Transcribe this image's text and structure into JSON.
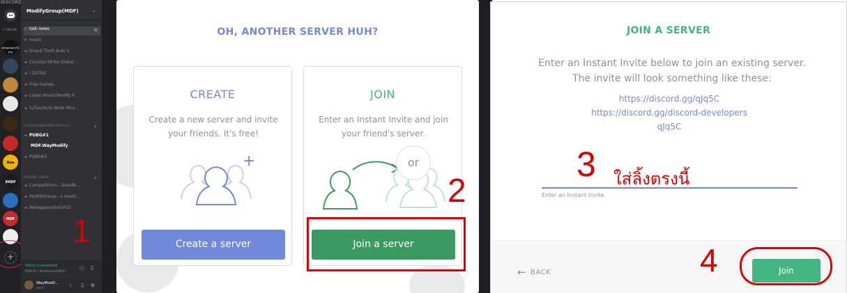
{
  "discord": {
    "brand": "DISCORD",
    "online_count": "5 ONLINE",
    "server_name": "ModifyGroup(MDF)",
    "guild_labels": [
      "สหายตายยากไม่ตาย",
      "Nua",
      "XHDF",
      "MDF"
    ],
    "channels": {
      "talk_news": "talk-news",
      "music": "music",
      "voice_1": [
        "Grand Theft Auto V",
        "Counter-Strike Global ...",
        "\\ DOTA2",
        "Free Games",
        "Listen Music(Modify P...",
        "ไม่ใมย(Auto Mute Micr..."
      ],
      "category_pubg": "PLAYERUNKNOWN'S BATTLEG...",
      "pubg1": "PUBG#1",
      "pubg1_member": "MDF.WayModify",
      "pubg2": "PUBG#2",
      "category_locking": "LOCKING ROOM",
      "locking_channels": [
        "Competitions - Standb...",
        "ModifyGroup - a meeti...",
        "Webapponsite(SEO)"
      ]
    },
    "voice_status": "Voice Connected",
    "voice_sub": "PUBG#1 / ModifyGroup(MDF)",
    "username": "WayModif...",
    "user_tag": "#4577",
    "step": "1"
  },
  "panel2": {
    "heading": "OH, ANOTHER SERVER HUH?",
    "create_title": "CREATE",
    "create_desc": "Create a new server and invite your friends. It's free!",
    "create_button": "Create a server",
    "or_label": "or",
    "join_title": "JOIN",
    "join_desc": "Enter an Instant Invite and join your friend's server.",
    "join_button": "Join a server",
    "step": "2"
  },
  "panel3": {
    "heading": "JOIN A SERVER",
    "description": "Enter an Instant Invite below to join an existing server. The invite will look something like these:",
    "examples": [
      "https://discord.gg/qJq5C",
      "https://discord.gg/discord-developers",
      "qJq5C"
    ],
    "input_value": "ใส่ลิ้งตรงนี้",
    "input_label": "Enter an Instant Invite",
    "back_label": "BACK",
    "join_button": "Join",
    "step3": "3",
    "step4": "4"
  },
  "colors": {
    "blurple": "#7289da",
    "green": "#43b581",
    "dark_green": "#3a9a5f",
    "annotation_red": "#e00000"
  }
}
